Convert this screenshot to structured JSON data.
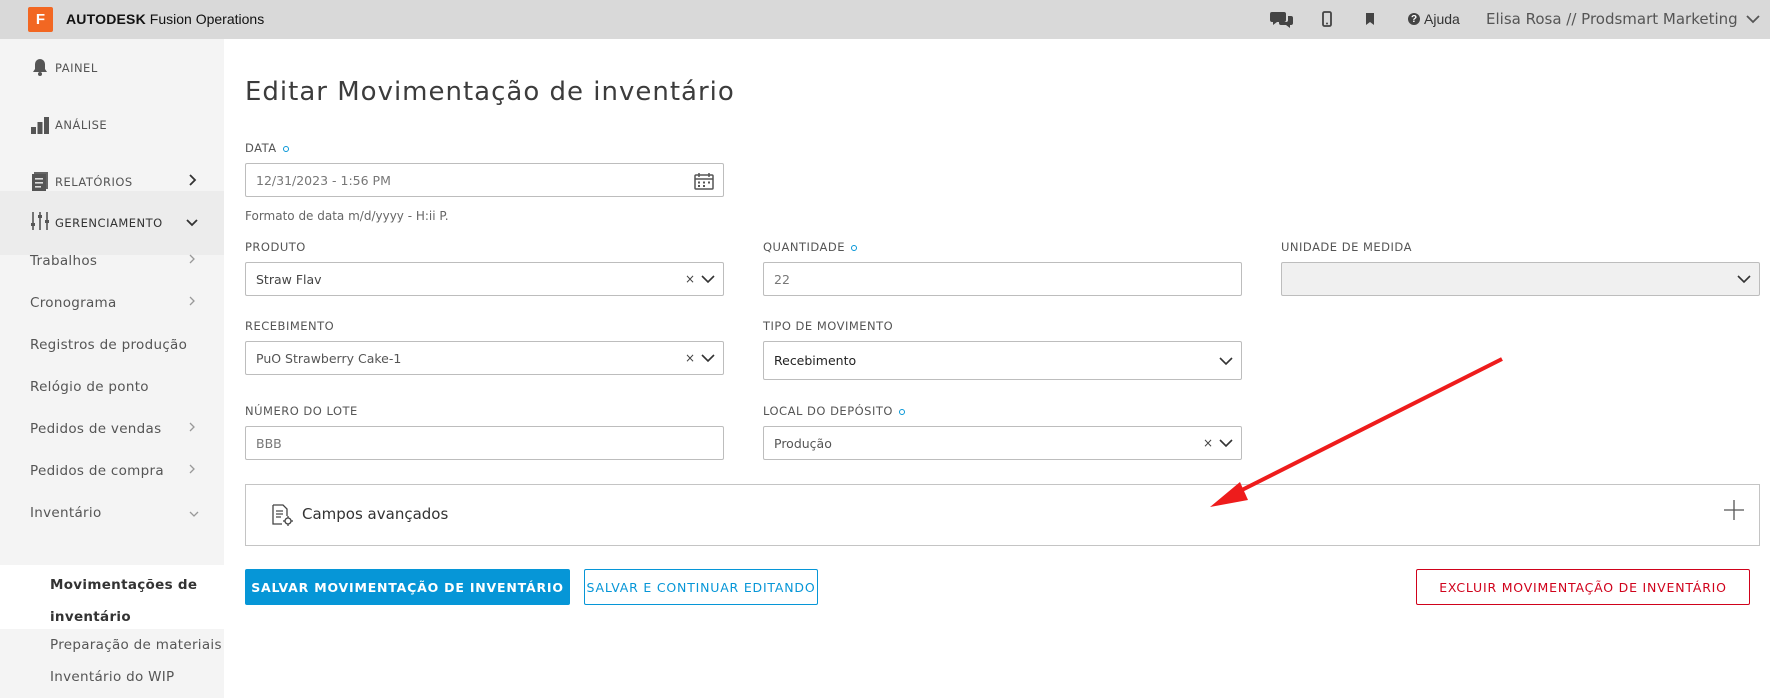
{
  "topbar": {
    "logo_letter": "F",
    "brand_bold": "AUTODESK",
    "brand_rest": " Fusion Operations",
    "help_label": "Ajuda",
    "user_label": "Elisa Rosa // Prodsmart Marketing",
    "icons": [
      "chat-icon",
      "mobile-icon",
      "bookmark-icon"
    ]
  },
  "sidebar": {
    "main": [
      {
        "label": "PAINEL",
        "icon": "bell-icon"
      },
      {
        "label": "ANÁLISE",
        "icon": "bar-chart-icon"
      },
      {
        "label": "RELATÓRIOS",
        "icon": "report-icon"
      },
      {
        "label": "GERENCIAMENTO",
        "icon": "sliders-icon"
      }
    ],
    "sub": [
      {
        "label": "Trabalhos"
      },
      {
        "label": "Cronograma"
      },
      {
        "label": "Registros de produção"
      },
      {
        "label": "Relógio de ponto"
      },
      {
        "label": "Pedidos de vendas"
      },
      {
        "label": "Pedidos de compra"
      },
      {
        "label": "Inventário"
      }
    ],
    "children": [
      {
        "label": "Movimentações de inventário"
      },
      {
        "label": "Preparação de materiais"
      },
      {
        "label": "Inventário do WIP"
      }
    ]
  },
  "page": {
    "title": "Editar Movimentação de inventário"
  },
  "form": {
    "data": {
      "label": "DATA",
      "value": "12/31/2023 - 1:56 PM",
      "hint": "Formato de data m/d/yyyy - H:ii P."
    },
    "produto": {
      "label": "PRODUTO",
      "value": "Straw Flav"
    },
    "quantidade": {
      "label": "QUANTIDADE",
      "value": "22"
    },
    "unidade": {
      "label": "UNIDADE DE MEDIDA",
      "value": ""
    },
    "recebimento": {
      "label": "RECEBIMENTO",
      "value": "PuO Strawberry Cake-1"
    },
    "tipo": {
      "label": "TIPO DE MOVIMENTO",
      "value": "Recebimento"
    },
    "lote": {
      "label": "NÚMERO DO LOTE",
      "value": "BBB"
    },
    "local": {
      "label": "LOCAL DO DEPÓSITO",
      "value": "Produção"
    },
    "advanced": {
      "label": "Campos avançados"
    }
  },
  "actions": {
    "save": "SALVAR MOVIMENTAÇÃO DE INVENTÁRIO",
    "save_continue": "SALVAR E CONTINUAR EDITANDO",
    "delete": "EXCLUIR MOVIMENTAÇÃO DE INVENTÁRIO"
  },
  "colors": {
    "accent": "#0696d7",
    "danger": "#d0021b",
    "brand": "#f26722",
    "annotation_arrow": "#ee1c1c"
  }
}
